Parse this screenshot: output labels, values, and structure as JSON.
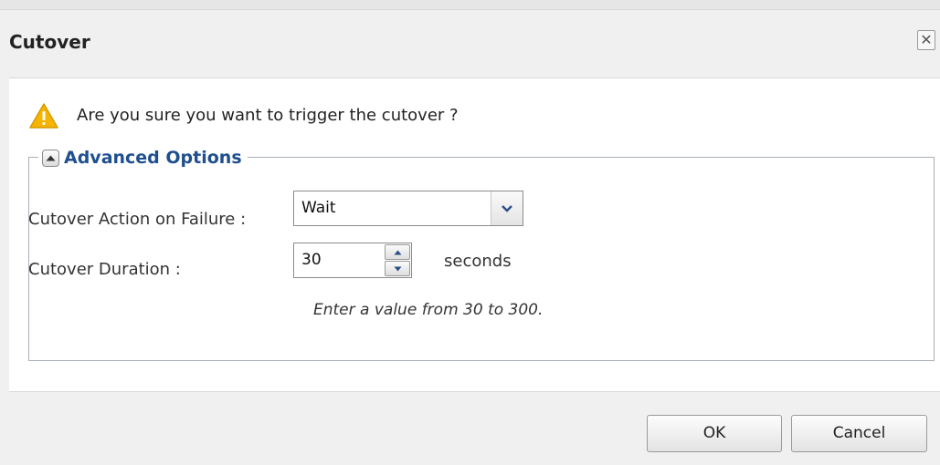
{
  "dialog": {
    "title": "Cutover",
    "close_label": "✕"
  },
  "message": {
    "icon": "warning-icon",
    "text": "Are you sure you want to trigger the cutover ?"
  },
  "advanced": {
    "legend": "Advanced Options",
    "toggle_icon": "collapse-up-icon",
    "action_label": "Cutover Action on Failure :",
    "action_value": "Wait",
    "duration_label": "Cutover Duration :",
    "duration_value": "30",
    "duration_unit": "seconds",
    "hint": "Enter a value from 30 to 300."
  },
  "buttons": {
    "ok": "OK",
    "cancel": "Cancel"
  },
  "colors": {
    "legend_text": "#1f4f8f",
    "warning": "#f5b400",
    "background": "#f0f0f0"
  }
}
